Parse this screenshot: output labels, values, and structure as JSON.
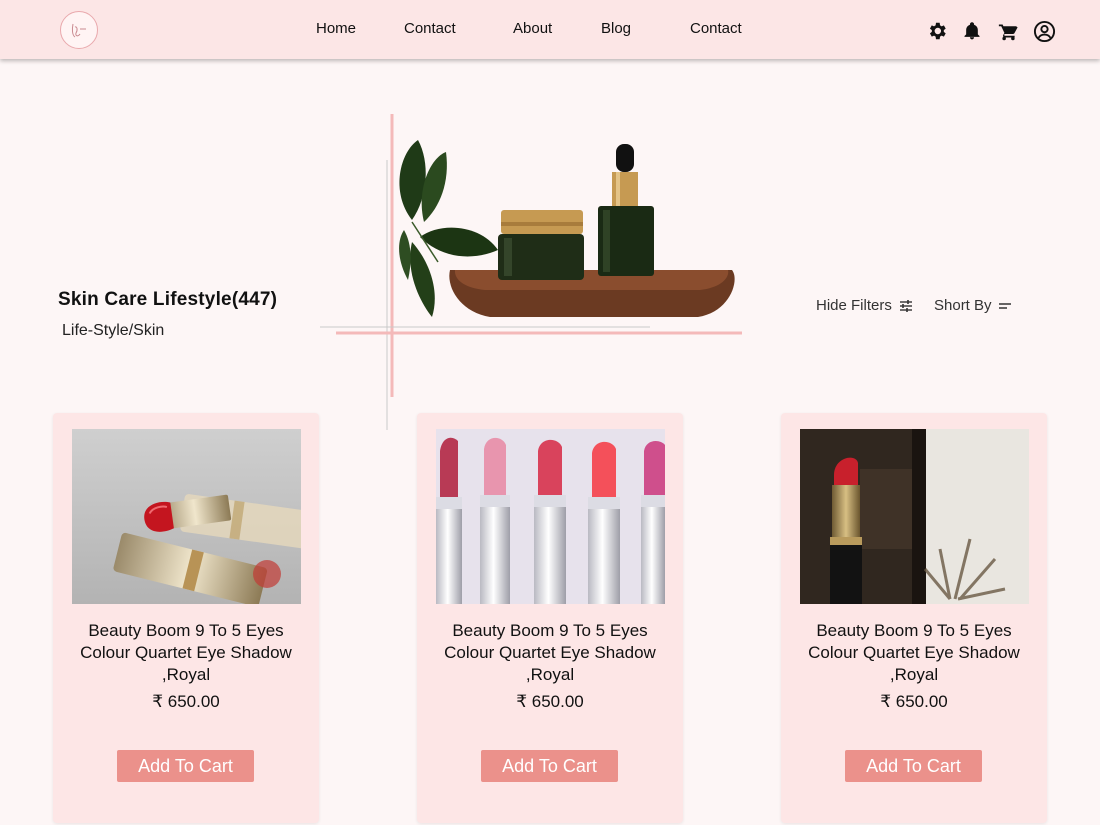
{
  "nav": {
    "links": [
      "Home",
      "Contact",
      "About",
      "Blog",
      "Contact"
    ]
  },
  "header_icons": [
    "gear-icon",
    "bell-icon",
    "cart-icon",
    "account-icon"
  ],
  "hero": {
    "title": "Skin Care Lifestyle(447)",
    "breadcrumb": "Life-Style/Skin"
  },
  "controls": {
    "hide_filters": "Hide Filters",
    "sort_by": "Short By"
  },
  "products": [
    {
      "name": "Beauty Boom 9 To 5 Eyes Colour Quartet Eye Shadow ,Royal",
      "price": "₹ 650.00",
      "button": "Add To Cart"
    },
    {
      "name": "Beauty Boom 9 To 5 Eyes Colour Quartet Eye Shadow ,Royal",
      "price": "₹ 650.00",
      "button": "Add To Cart"
    },
    {
      "name": "Beauty Boom 9 To 5 Eyes Colour Quartet Eye Shadow ,Royal",
      "price": "₹ 650.00",
      "button": "Add To Cart"
    }
  ],
  "colors": {
    "header_bg": "#fce6e6",
    "page_bg": "#fdf6f6",
    "card_bg": "#fde6e6",
    "button_bg": "#eb918b",
    "accent_line": "#f4b9b9"
  }
}
